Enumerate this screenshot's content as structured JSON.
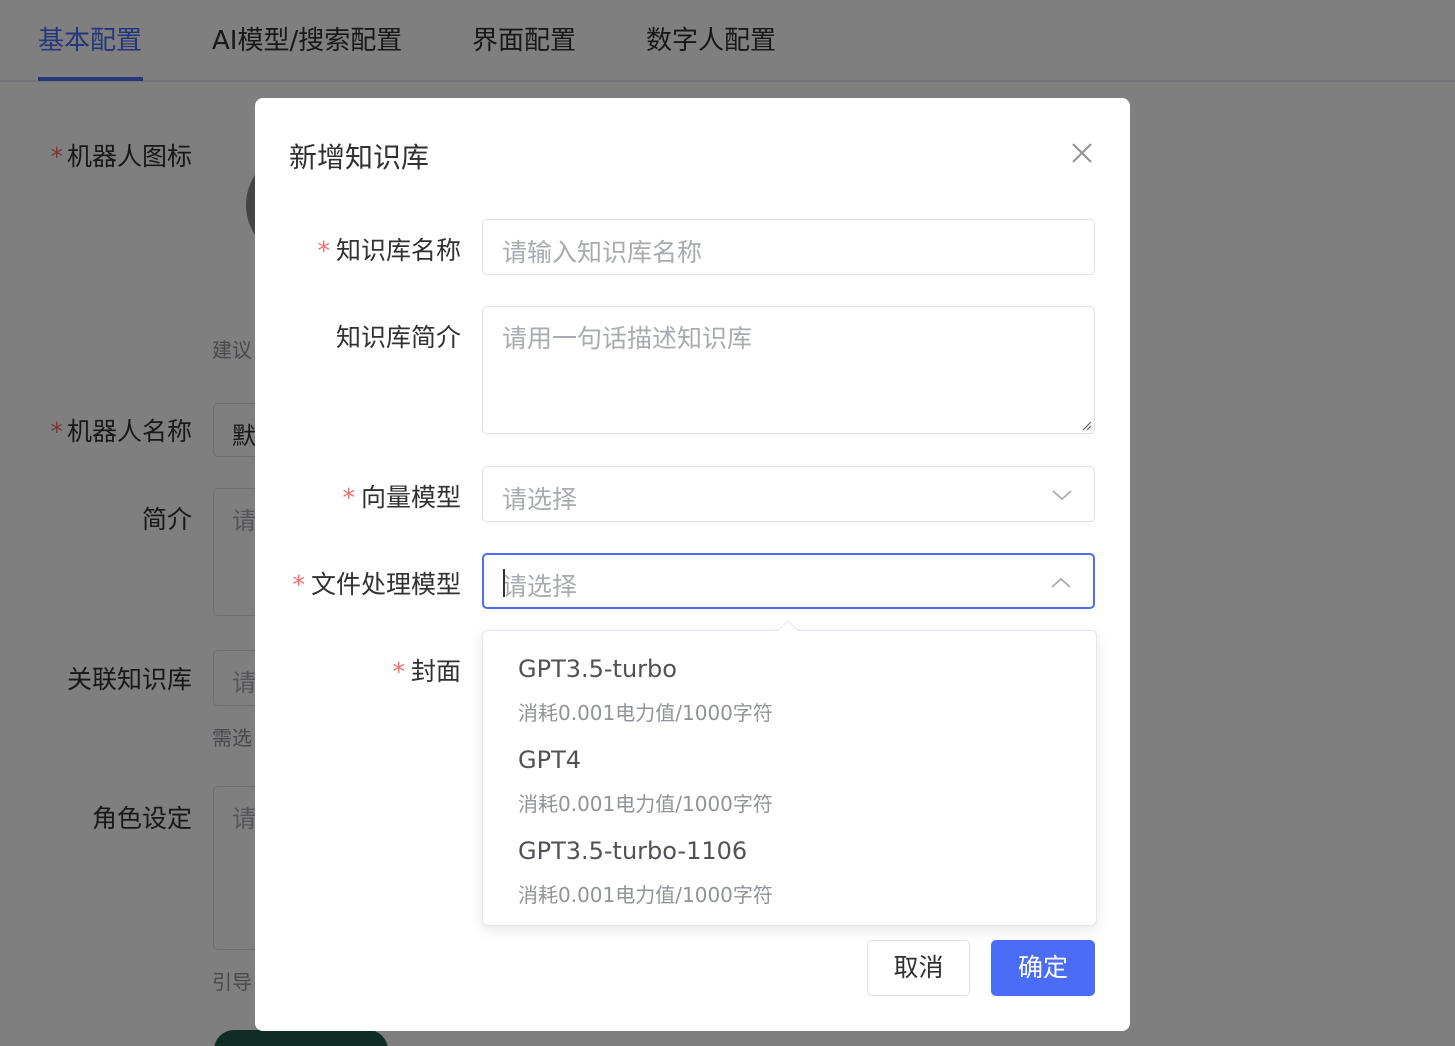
{
  "tabs": [
    "基本配置",
    "AI模型/搜索配置",
    "界面配置",
    "数字人配置"
  ],
  "background": {
    "robot_icon_label": "机器人图标",
    "icon_hint": "建议",
    "robot_name_label": "机器人名称",
    "robot_name_value": "默",
    "intro_label": "简介",
    "intro_placeholder": "请",
    "kb_label": "关联知识库",
    "kb_placeholder": "请",
    "kb_hint": "需选",
    "role_label": "角色设定",
    "role_placeholder": "请",
    "role_hint": "引导"
  },
  "dialog": {
    "title": "新增知识库",
    "fields": {
      "name": {
        "label": "知识库名称",
        "placeholder": "请输入知识库名称"
      },
      "desc": {
        "label": "知识库简介",
        "placeholder": "请用一句话描述知识库"
      },
      "vector": {
        "label": "向量模型",
        "placeholder": "请选择"
      },
      "file": {
        "label": "文件处理模型",
        "placeholder": "请选择"
      },
      "cover": {
        "label": "封面"
      }
    },
    "options": [
      {
        "name": "GPT3.5-turbo",
        "desc": "消耗0.001电力值/1000字符"
      },
      {
        "name": "GPT4",
        "desc": "消耗0.001电力值/1000字符"
      },
      {
        "name": "GPT3.5-turbo-1106",
        "desc": "消耗0.001电力值/1000字符"
      }
    ],
    "cancel_label": "取消",
    "confirm_label": "确定"
  },
  "colors": {
    "primary": "#4a6cf7",
    "required": "#f56c6c",
    "overlay": "rgba(0,0,0,0.5)"
  },
  "icons": {
    "close": "close-icon",
    "select_closed": "chevron-down-icon",
    "select_open": "chevron-up-icon"
  }
}
